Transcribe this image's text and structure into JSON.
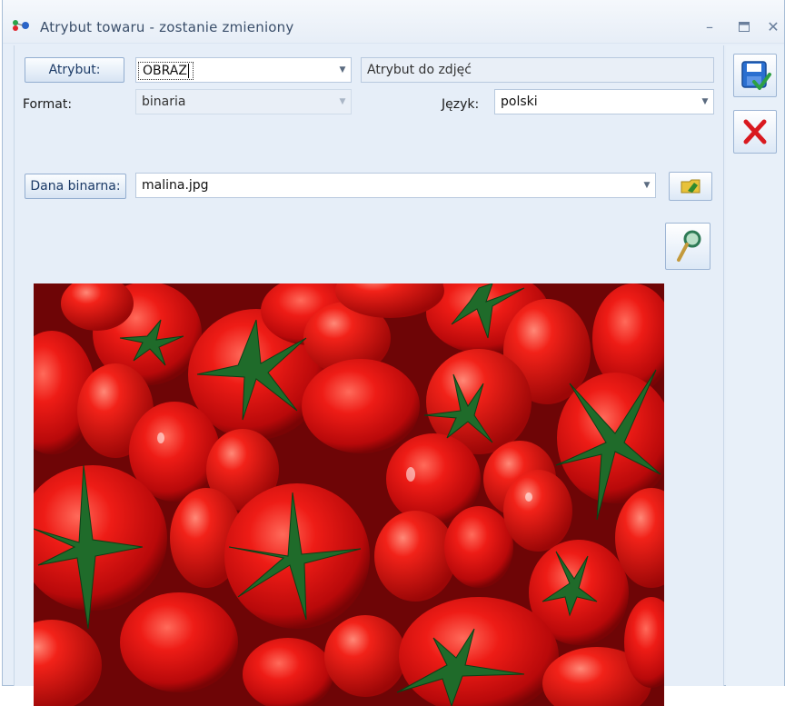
{
  "window": {
    "title": "Atrybut towaru - zostanie zmieniony",
    "controls": [
      "minimize-icon",
      "maximize-icon",
      "close-icon"
    ]
  },
  "form": {
    "atrybut_button": "Atrybut:",
    "atrybut_value": "OBRAZ",
    "atrybut_description": "Atrybut do zdjęć",
    "format_label": "Format:",
    "format_value": "binaria",
    "jezyk_label": "Język:",
    "jezyk_value": "polski",
    "dana_binarna_button": "Dana binarna:",
    "dana_binarna_value": "malina.jpg"
  },
  "image": {
    "description_icon": "tomatoes-photo"
  },
  "actions": {
    "save_icon": "save-icon",
    "cancel_icon": "cancel-icon",
    "attach_icon": "attach-file-icon",
    "preview_icon": "magnifier-icon"
  },
  "colors": {
    "accent": "#1b3a66",
    "window_bg": "#e6eef8",
    "cancel_red": "#d9191f",
    "save_blue": "#2a6fd0",
    "save_green": "#2ea043"
  }
}
